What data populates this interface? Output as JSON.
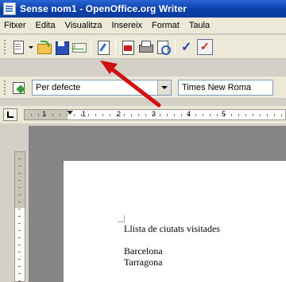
{
  "window": {
    "title": "Sense nom1 - OpenOffice.org Writer"
  },
  "menubar": {
    "items": [
      "Fitxer",
      "Edita",
      "Visualitza",
      "Insereix",
      "Format",
      "Taula"
    ]
  },
  "standard_toolbar": {
    "icons": [
      "new-document-icon",
      "dropdown-arrow-icon",
      "open-folder-icon",
      "save-icon",
      "email-icon",
      "edit-file-icon",
      "export-pdf-icon",
      "print-icon",
      "page-preview-icon",
      "spellcheck-icon",
      "autospellcheck-icon"
    ]
  },
  "formatting_toolbar": {
    "paragraph_style": "Per defecte",
    "font_name": "Times New Roma"
  },
  "ruler": {
    "numbers": [
      "1",
      "1",
      "2",
      "3",
      "4",
      "5"
    ]
  },
  "document": {
    "lines": [
      "Llista de ciutats visitades",
      "",
      "Barcelona",
      "Tarragona"
    ]
  },
  "annotation": {
    "arrow_color": "#d01010"
  }
}
